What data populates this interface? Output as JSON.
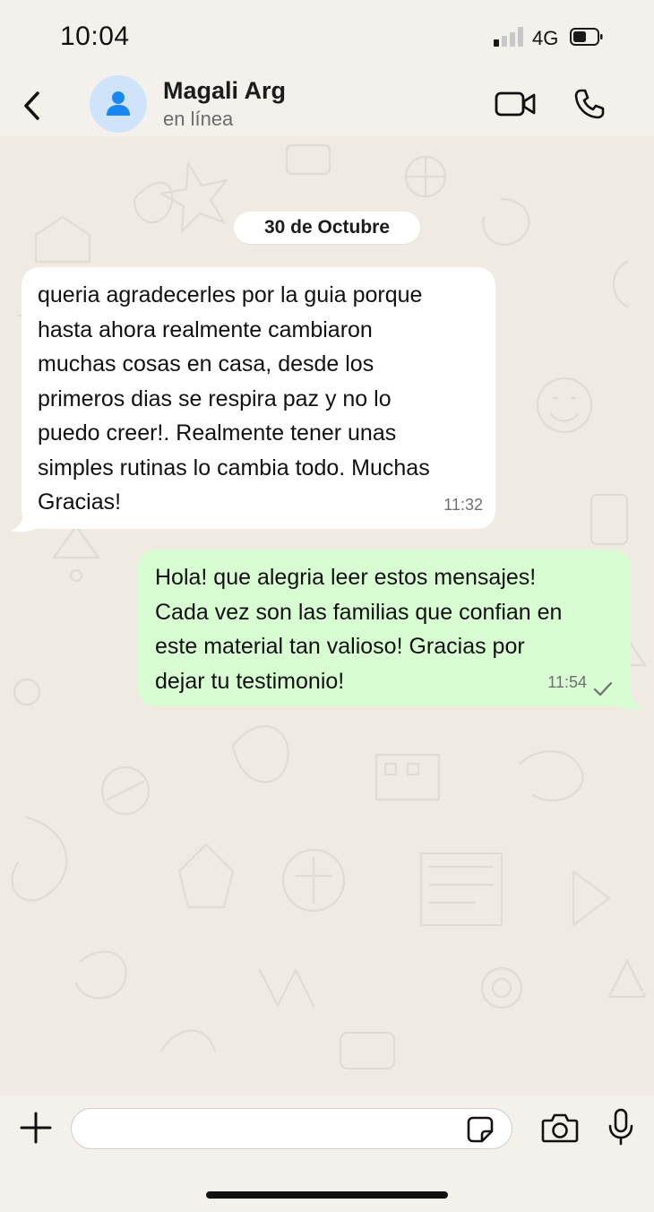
{
  "status_bar": {
    "time": "10:04",
    "network": "4G",
    "signal_bars_active": 1,
    "signal_bars_total": 4,
    "battery_level": 0.45,
    "battery_icon": "battery-icon",
    "signal_icon": "signal-icon"
  },
  "header": {
    "contact_name": "Magali Arg",
    "contact_status": "en línea",
    "icons": [
      "chevron-left-icon",
      "person-icon",
      "video-camera-icon",
      "phone-icon"
    ]
  },
  "chat": {
    "date_separator": "30 de Octubre",
    "messages": [
      {
        "direction": "incoming",
        "text": "queria agradecerles por la guia porque\nhasta ahora realmente cambiaron\nmuchas cosas en casa, desde los\nprimeros dias se respira paz y no lo\npuedo creer!. Realmente tener unas\nsimples rutinas lo cambia todo. Muchas\nGracias!",
        "time": "11:32"
      },
      {
        "direction": "outgoing",
        "text": "Hola! que alegria leer estos mensajes!\nCada vez son las familias que confian en\neste material tan valioso! Gracias por\ndejar tu testimonio!",
        "time": "11:54",
        "status_icon": "single-check-icon"
      }
    ]
  },
  "composer": {
    "input_value": "",
    "icons": [
      "plus-icon",
      "sticker-icon",
      "camera-icon",
      "microphone-icon"
    ]
  },
  "colors": {
    "background": "#f4f1ec",
    "wallpaper": "#efeae2",
    "incoming_bubble": "#ffffff",
    "outgoing_bubble": "#d9fdd3",
    "avatar_bg": "#cfe3fb",
    "avatar_icon": "#1a86f0",
    "timestamp": "#6f6f6f"
  }
}
